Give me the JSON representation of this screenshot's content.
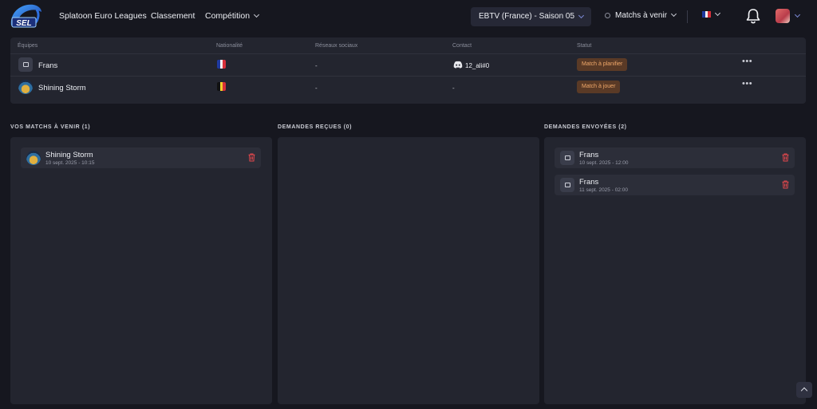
{
  "nav": {
    "brand_logo_text": "SEL",
    "links": [
      "Splatoon Euro Leagues",
      "Classement",
      "Compétition"
    ],
    "season_select": "EBTV (France) - Saison 05",
    "matches_filter": "Matchs à venir",
    "language_flag": "fr"
  },
  "teams_table": {
    "headers": [
      "Équipes",
      "Nationalité",
      "Réseaux sociaux",
      "Contact",
      "Statut"
    ],
    "rows": [
      {
        "team": "Frans",
        "nationality": "France",
        "social": "-",
        "contact": "12_ali#0",
        "status": "Match à planifier"
      },
      {
        "team": "Shining Storm",
        "nationality": "Belgique",
        "social": "-",
        "contact": "-",
        "status": "Match à jouer"
      }
    ]
  },
  "columns": {
    "upcoming": {
      "title": "VOS MATCHS À VENIR (1)",
      "items": [
        {
          "team": "Shining Storm",
          "date": "10 sept. 2025 - 10:15"
        }
      ]
    },
    "received": {
      "title": "DEMANDES REÇUES (0)",
      "items": []
    },
    "sent": {
      "title": "DEMANDES ENVOYÉES (2)",
      "items": [
        {
          "team": "Frans",
          "date": "10 sept. 2025 - 12:00"
        },
        {
          "team": "Frans",
          "date": "11 sept. 2025 - 02:00"
        }
      ]
    }
  },
  "colors": {
    "background": "#16171f",
    "panel": "#23252f",
    "accent": "#7d8ad6",
    "status_orange": "#f0a86a",
    "danger": "#e5484d"
  }
}
